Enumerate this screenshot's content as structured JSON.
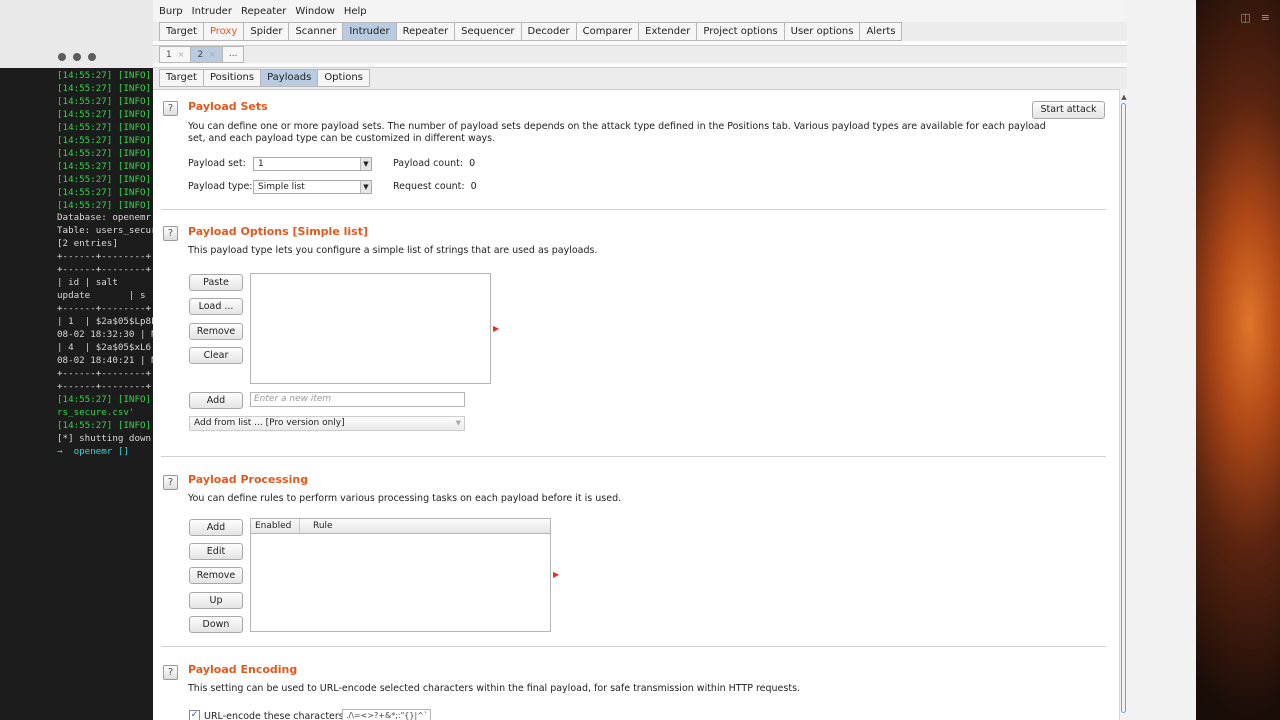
{
  "terminal": {
    "lines": [
      {
        "t": "[14:55:27] [INFO]",
        "c": "g"
      },
      {
        "t": "[14:55:27] [INFO]",
        "c": "g"
      },
      {
        "t": "[14:55:27] [INFO]",
        "c": "g"
      },
      {
        "t": "[14:55:27] [INFO]",
        "c": "g"
      },
      {
        "t": "[14:55:27] [INFO]",
        "c": "g"
      },
      {
        "t": "[14:55:27] [INFO]",
        "c": "g"
      },
      {
        "t": "[14:55:27] [INFO]",
        "c": "g"
      },
      {
        "t": "[14:55:27] [INFO]",
        "c": "g"
      },
      {
        "t": "[14:55:27] [INFO]",
        "c": "g"
      },
      {
        "t": "[14:55:27] [INFO]",
        "c": "g"
      },
      {
        "t": "[14:55:27] [INFO]",
        "c": "g"
      },
      {
        "t": "Database: openemr",
        "c": ""
      },
      {
        "t": "Table: users_secure",
        "c": ""
      },
      {
        "t": "[2 entries]",
        "c": ""
      },
      {
        "t": "+------+--------+",
        "c": ""
      },
      {
        "t": "",
        "c": ""
      },
      {
        "t": "+------+--------+",
        "c": ""
      },
      {
        "t": "| id | salt",
        "c": ""
      },
      {
        "t": "update       | s",
        "c": ""
      },
      {
        "t": "+------+--------+",
        "c": ""
      },
      {
        "t": "| 1  | $2a$05$Lp8F",
        "c": ""
      },
      {
        "t": "08-02 18:32:30 | N",
        "c": ""
      },
      {
        "t": "| 4  | $2a$05$xL6",
        "c": ""
      },
      {
        "t": "08-02 18:40:21 | N",
        "c": ""
      },
      {
        "t": "+------+--------+",
        "c": ""
      },
      {
        "t": "",
        "c": ""
      },
      {
        "t": "+------+--------+",
        "c": ""
      },
      {
        "t": "",
        "c": ""
      },
      {
        "t": "[14:55:27] [INFO]",
        "c": "g"
      },
      {
        "t": "rs_secure.csv'",
        "c": "g"
      },
      {
        "t": "[14:55:27] [INFO]",
        "c": "g"
      },
      {
        "t": "",
        "c": ""
      },
      {
        "t": "[*] shutting down",
        "c": ""
      },
      {
        "t": "",
        "c": ""
      },
      {
        "t": "→  openemr []",
        "c": "c"
      }
    ]
  },
  "menubar": [
    "Burp",
    "Intruder",
    "Repeater",
    "Window",
    "Help"
  ],
  "main_tabs": [
    "Target",
    "Proxy",
    "Spider",
    "Scanner",
    "Intruder",
    "Repeater",
    "Sequencer",
    "Decoder",
    "Comparer",
    "Extender",
    "Project options",
    "User options",
    "Alerts"
  ],
  "num_tabs": [
    "1",
    "2",
    "..."
  ],
  "sub_tabs": [
    "Target",
    "Positions",
    "Payloads",
    "Options"
  ],
  "payload_sets": {
    "title": "Payload Sets",
    "desc": "You can define one or more payload sets. The number of payload sets depends on the attack type defined in the Positions tab. Various payload types are available for each payload set, and each payload type can be customized in different ways.",
    "set_label": "Payload set:",
    "set_value": "1",
    "type_label": "Payload type:",
    "type_value": "Simple list",
    "count_label": "Payload count:",
    "count_value": "0",
    "req_label": "Request count:",
    "req_value": "0",
    "start_button": "Start attack"
  },
  "payload_options": {
    "title": "Payload Options [Simple list]",
    "desc": "This payload type lets you configure a simple list of strings that are used as payloads.",
    "buttons": [
      "Paste",
      "Load ...",
      "Remove",
      "Clear"
    ],
    "add_button": "Add",
    "add_placeholder": "Enter a new item",
    "add_from_list": "Add from list ... [Pro version only]"
  },
  "payload_processing": {
    "title": "Payload Processing",
    "desc": "You can define rules to perform various processing tasks on each payload before it is used.",
    "buttons": [
      "Add",
      "Edit",
      "Remove",
      "Up",
      "Down"
    ],
    "col_enabled": "Enabled",
    "col_rule": "Rule"
  },
  "payload_encoding": {
    "title": "Payload Encoding",
    "desc": "This setting can be used to URL-encode selected characters within the final payload, for safe transmission within HTTP requests.",
    "checkbox_label": "URL-encode these characters:",
    "chars": "./\\=<>?+&*;:\"{}|^`"
  }
}
